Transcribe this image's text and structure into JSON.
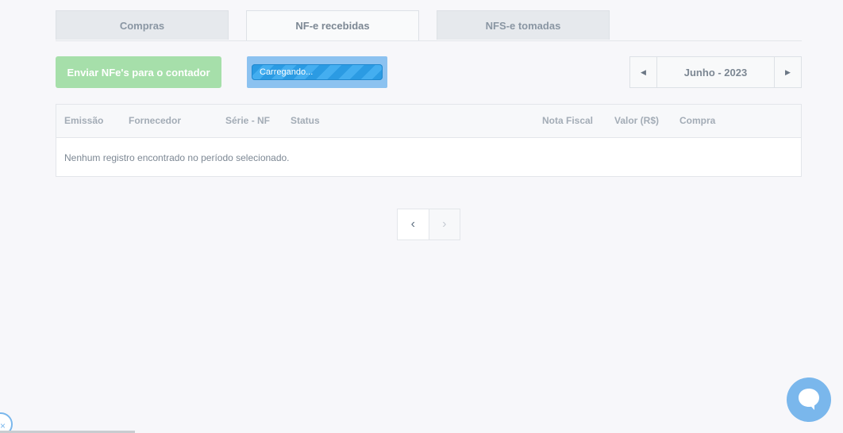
{
  "tabs": [
    {
      "label": "Compras",
      "active": false
    },
    {
      "label": "NF-e recebidas",
      "active": true
    },
    {
      "label": "NFS-e tomadas",
      "active": false
    }
  ],
  "toolbar": {
    "send_button": "Enviar NFe's para o contador",
    "loading_text": "Carregando...",
    "month_label": "Junho - 2023",
    "prev_month_icon": "triangle-left-icon",
    "next_month_icon": "triangle-right-icon"
  },
  "table": {
    "columns": [
      "Emissão",
      "Fornecedor",
      "Série - NF",
      "Status",
      "Nota Fiscal",
      "Valor (R$)",
      "Compra"
    ],
    "empty_message": "Nenhum registro encontrado no período selecionado."
  },
  "pagination": {
    "prev": "‹",
    "next": "›"
  },
  "colors": {
    "send_button": "#a6dfaa",
    "loading": "#8cc2f0",
    "chat": "#7ab7ec"
  }
}
